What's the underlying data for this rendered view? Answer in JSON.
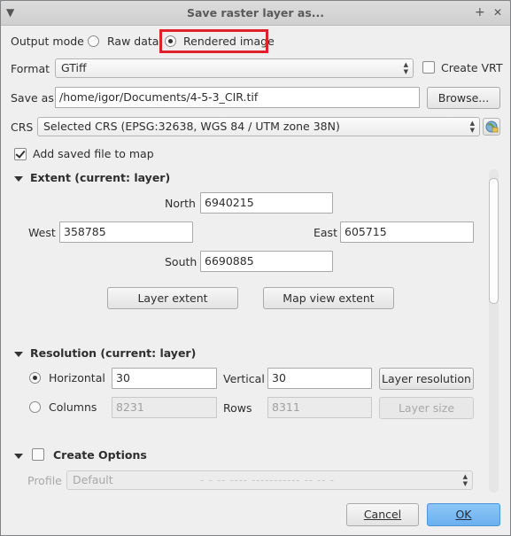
{
  "window": {
    "title": "Save raster layer as...",
    "pin_glyph": "+",
    "close_glyph": "✕"
  },
  "output_mode": {
    "label": "Output mode",
    "options": [
      {
        "label": "Raw data",
        "selected": false
      },
      {
        "label": "Rendered image",
        "selected": true
      }
    ]
  },
  "format": {
    "label": "Format",
    "value": "GTiff",
    "create_vrt_label": "Create VRT",
    "create_vrt_checked": false
  },
  "save_as": {
    "label": "Save as",
    "value": "/home/igor/Documents/4-5-3_CIR.tif",
    "browse_label": "Browse..."
  },
  "crs": {
    "label": "CRS",
    "value": "Selected CRS (EPSG:32638, WGS 84 / UTM zone 38N)",
    "select_icon": "globe-icon"
  },
  "add_to_map": {
    "label": "Add saved file to map",
    "checked": true
  },
  "extent": {
    "title": "Extent (current: layer)",
    "north_label": "North",
    "north_value": "6940215",
    "west_label": "West",
    "west_value": "358785",
    "east_label": "East",
    "east_value": "605715",
    "south_label": "South",
    "south_value": "6690885",
    "layer_extent_button": "Layer extent",
    "map_view_extent_button": "Map view extent"
  },
  "resolution": {
    "title": "Resolution (current: layer)",
    "horizontal_label": "Horizontal",
    "horizontal_value": "30",
    "vertical_label": "Vertical",
    "vertical_value": "30",
    "layer_resolution_button": "Layer resolution",
    "columns_label": "Columns",
    "columns_value": "8231",
    "rows_label": "Rows",
    "rows_value": "8311",
    "layer_size_button": "Layer size",
    "mode_horizontal_selected": true
  },
  "create_options": {
    "title": "Create Options",
    "checked": false,
    "profile_label": "Profile",
    "profile_value": "Default",
    "profile_center_text": "- - -- ---- -----------  -- -- -"
  },
  "footer": {
    "cancel_label": "Cancel",
    "ok_label": "OK"
  },
  "colors": {
    "highlight": "#e0202a",
    "primary_button": "#6cb0ef"
  }
}
